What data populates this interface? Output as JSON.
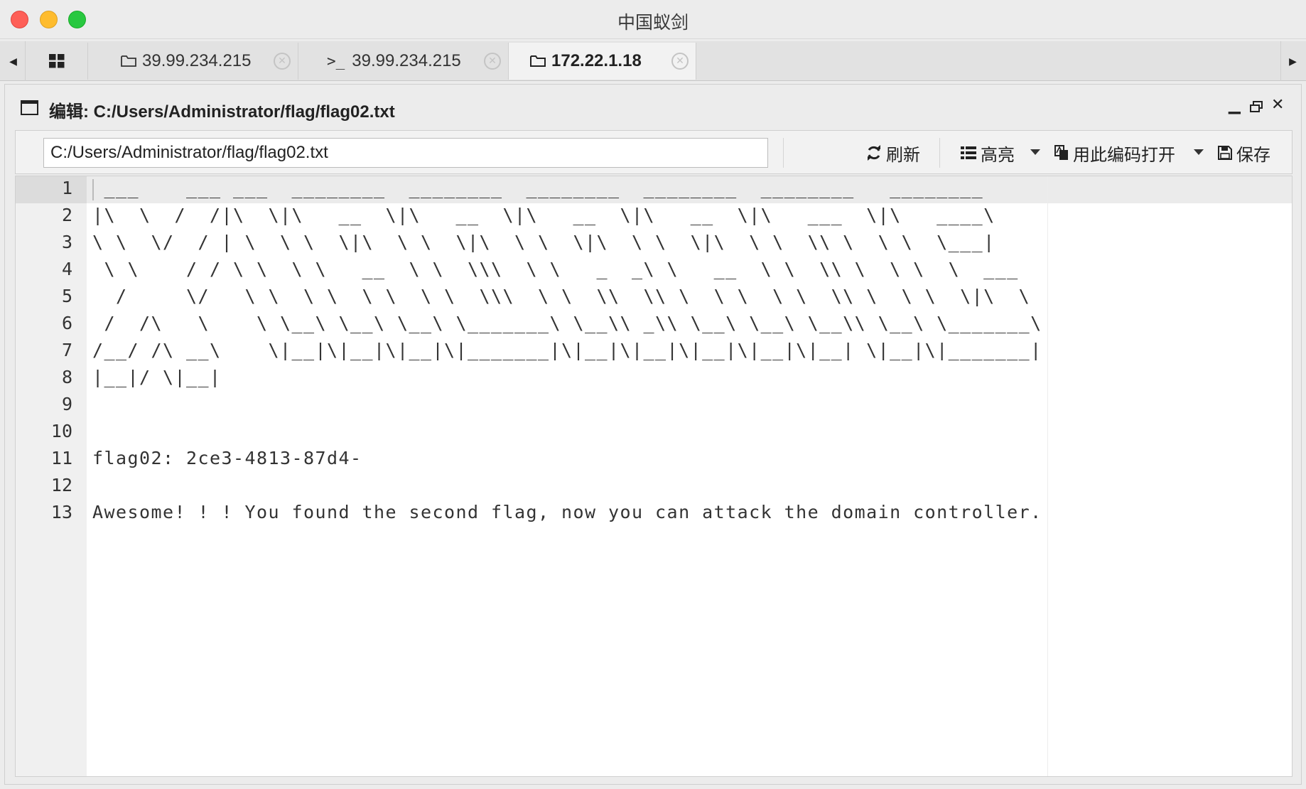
{
  "window": {
    "title": "中国蚁剑"
  },
  "tabs": [
    {
      "type": "home",
      "icon": "grid-icon"
    },
    {
      "type": "files",
      "icon": "folder-icon",
      "label": "39.99.234.215"
    },
    {
      "type": "terminal",
      "icon": "terminal-icon",
      "label": "39.99.234.215"
    },
    {
      "type": "files",
      "icon": "folder-icon",
      "label": "172.22.1.18",
      "active": true
    }
  ],
  "editor": {
    "title": "编辑: C:/Users/Administrator/flag/flag02.txt",
    "path": "C:/Users/Administrator/flag/flag02.txt",
    "toolbar": {
      "refresh": "刷新",
      "highlight": "高亮",
      "encoding": "用此编码打开",
      "save": "保存"
    },
    "lines": [
      {
        "n": "1",
        "text": " ___    ___ ___  ________  ________  ________  ________  ________   ________"
      },
      {
        "n": "2",
        "text": "|\\  \\  /  /|\\  \\|\\   __  \\|\\   __  \\|\\   __  \\|\\   __  \\|\\   ___  \\|\\   ____\\"
      },
      {
        "n": "3",
        "text": "\\ \\  \\/  / | \\  \\ \\  \\|\\  \\ \\  \\|\\  \\ \\  \\|\\  \\ \\  \\|\\  \\ \\  \\\\ \\  \\ \\  \\___|"
      },
      {
        "n": "4",
        "text": " \\ \\    / / \\ \\  \\ \\   __  \\ \\  \\\\\\  \\ \\   _  _\\ \\   __  \\ \\  \\\\ \\  \\ \\  \\  ___"
      },
      {
        "n": "5",
        "text": "  /     \\/   \\ \\  \\ \\  \\ \\  \\ \\  \\\\\\  \\ \\  \\\\  \\\\ \\  \\ \\  \\ \\  \\\\ \\  \\ \\  \\|\\  \\"
      },
      {
        "n": "6",
        "text": " /  /\\   \\    \\ \\__\\ \\__\\ \\__\\ \\_______\\ \\__\\\\ _\\\\ \\__\\ \\__\\ \\__\\\\ \\__\\ \\_______\\"
      },
      {
        "n": "7",
        "text": "/__/ /\\ __\\    \\|__|\\|__|\\|__|\\|_______|\\|__|\\|__|\\|__|\\|__|\\|__| \\|__|\\|_______|"
      },
      {
        "n": "8",
        "text": "|__|/ \\|__|"
      },
      {
        "n": "9",
        "text": ""
      },
      {
        "n": "10",
        "text": ""
      },
      {
        "n": "11",
        "text": "flag02: 2ce3-4813-87d4-"
      },
      {
        "n": "12",
        "text": ""
      },
      {
        "n": "13",
        "text": "Awesome! ! ! You found the second flag, now you can attack the domain controller."
      }
    ]
  }
}
